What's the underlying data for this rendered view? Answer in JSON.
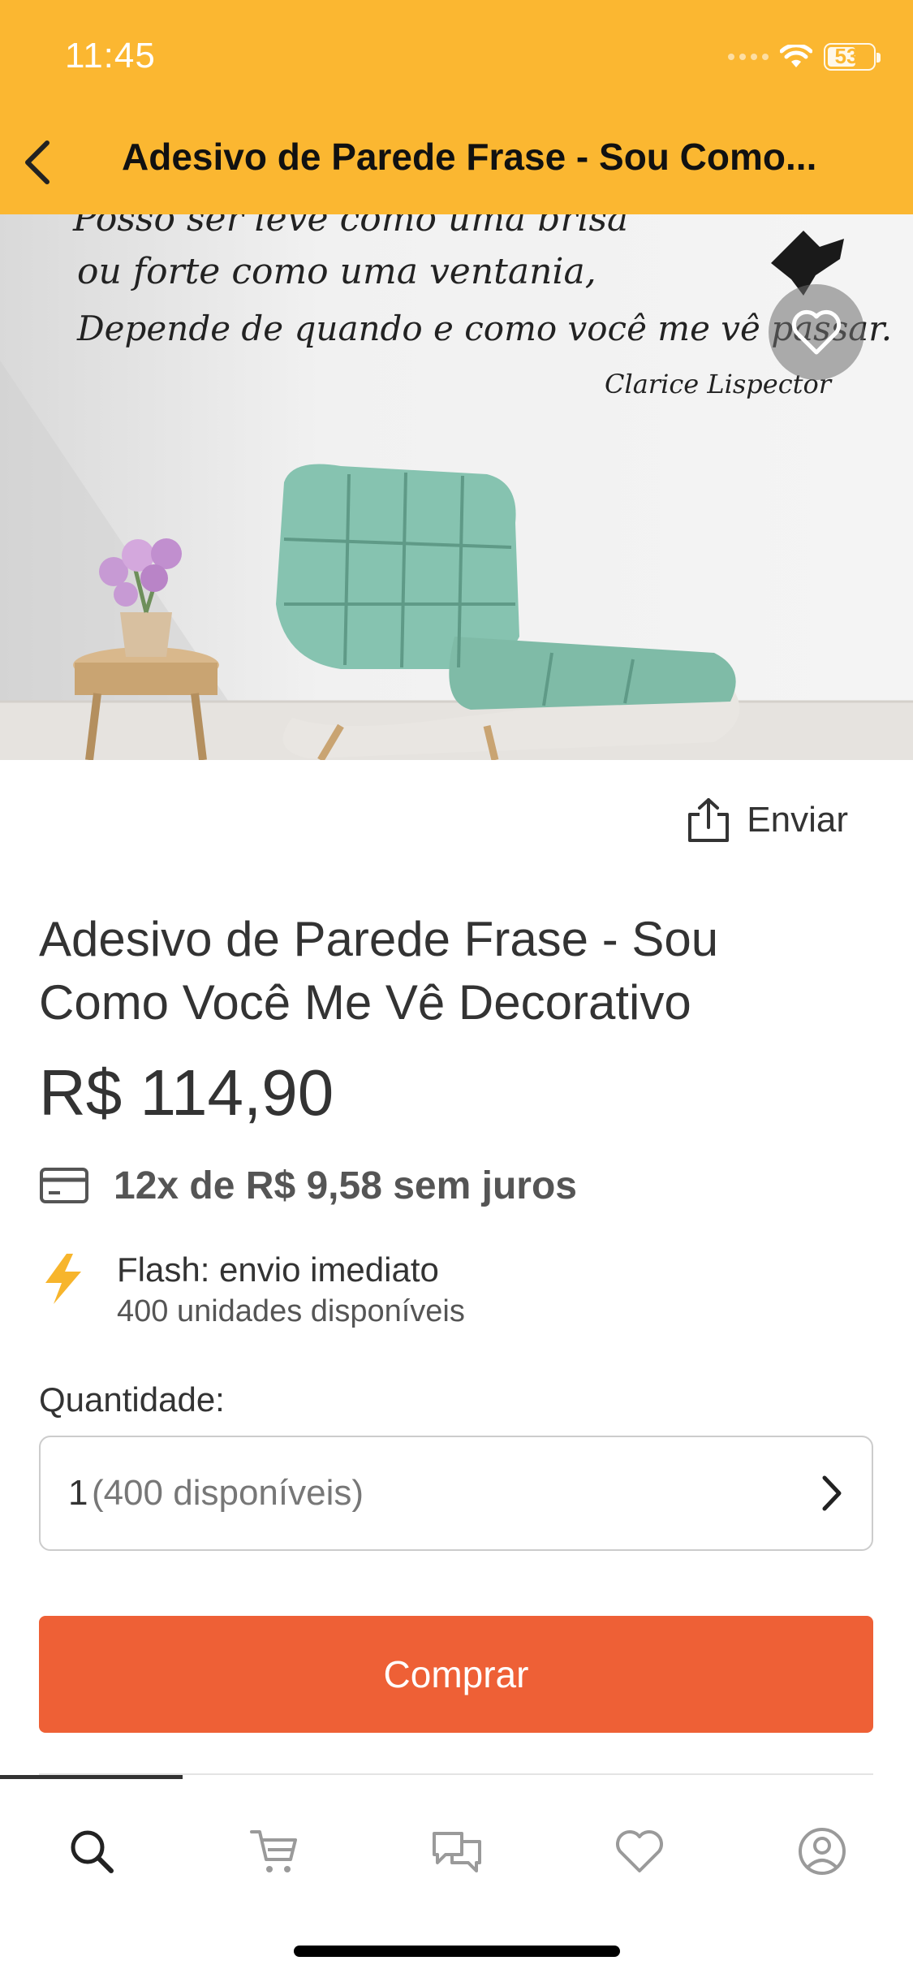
{
  "status_bar": {
    "time": "11:45",
    "battery": "53"
  },
  "header": {
    "title": "Adesivo de Parede Frase - Sou Como..."
  },
  "image": {
    "quote_line1": "Posso ser leve como uma brisa",
    "quote_line2": "ou forte como uma ventania,",
    "quote_line3": "Depende de quando e como você me vê passar.",
    "quote_author": "Clarice Lispector"
  },
  "share": {
    "label": "Enviar"
  },
  "product": {
    "title": "Adesivo de Parede Frase - Sou Como Você Me Vê Decorativo",
    "price": "R$ 114,90",
    "installments": "12x de R$ 9,58 sem juros",
    "shipping_title": "Flash: envio imediato",
    "shipping_subtitle": "400 unidades disponíveis"
  },
  "quantity": {
    "label": "Quantidade:",
    "value": "1",
    "available": "(400 disponíveis)"
  },
  "buy_button": {
    "label": "Comprar"
  },
  "tabbar": {
    "items": [
      {
        "icon": "search-icon",
        "active": true
      },
      {
        "icon": "cart-icon",
        "active": false
      },
      {
        "icon": "chat-icon",
        "active": false
      },
      {
        "icon": "heart-icon",
        "active": false
      },
      {
        "icon": "profile-icon",
        "active": false
      }
    ]
  },
  "colors": {
    "header": "#FBB731",
    "buy": "#EE6036",
    "flash": "#F7B52C"
  }
}
